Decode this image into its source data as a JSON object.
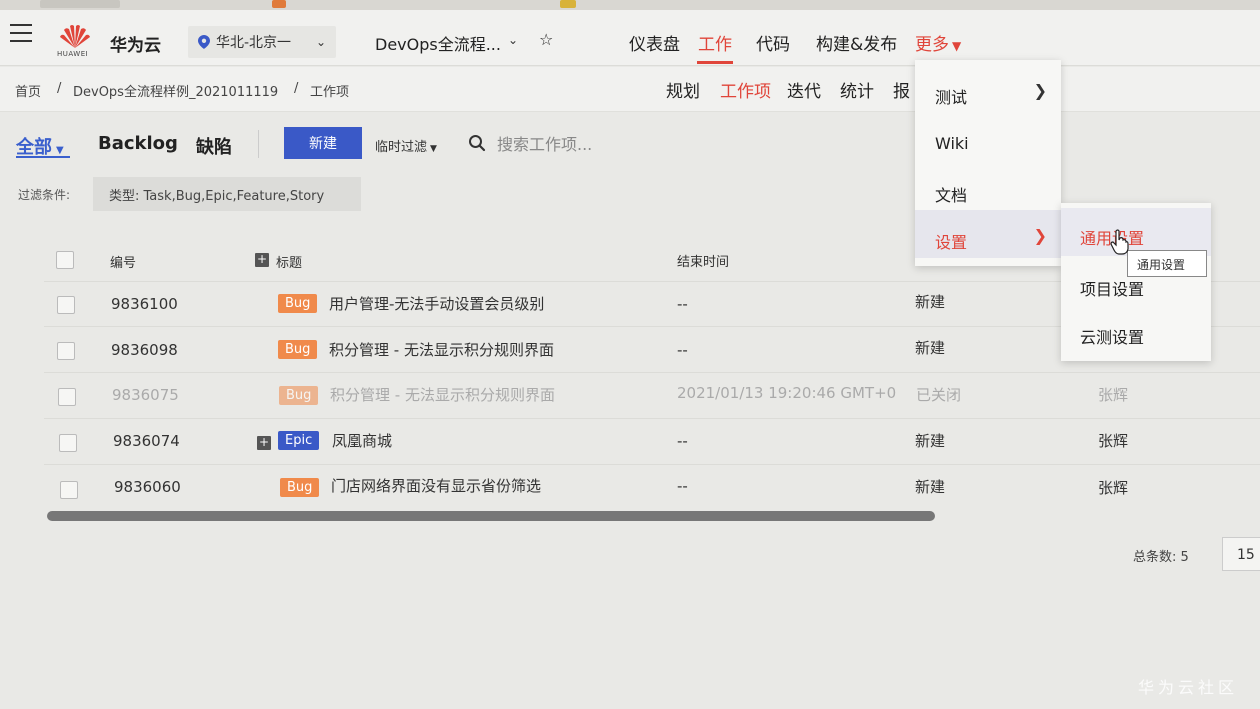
{
  "header": {
    "brand": "华为云",
    "logo_text": "HUAWEI",
    "region": "华北-北京一",
    "project": "DevOps全流程...",
    "nav": [
      "仪表盘",
      "工作",
      "代码",
      "构建&发布",
      "更多"
    ],
    "active_nav": "工作"
  },
  "breadcrumb": {
    "items": [
      "首页",
      "DevOps全流程样例_2021011119",
      "工作项"
    ],
    "separator": "/"
  },
  "subnav": [
    "规划",
    "工作项",
    "迭代",
    "统计",
    "报"
  ],
  "toolbar": {
    "tabs": [
      "全部",
      "Backlog",
      "缺陷"
    ],
    "new_button": "新建",
    "temp_filter": "临时过滤",
    "search_placeholder": "搜索工作项...",
    "filter_label": "过滤条件:",
    "filter_value": "类型: Task,Bug,Epic,Feature,Story"
  },
  "table": {
    "headers": {
      "id": "编号",
      "title": "标题",
      "end_time": "结束时间"
    },
    "rows": [
      {
        "id": "9836100",
        "type": "Bug",
        "title": "用户管理-无法手动设置会员级别",
        "end_time": "--",
        "status": "新建",
        "assignee": ""
      },
      {
        "id": "9836098",
        "type": "Bug",
        "title": "积分管理 - 无法显示积分规则界面",
        "end_time": "--",
        "status": "新建",
        "assignee": ""
      },
      {
        "id": "9836075",
        "type": "Bug",
        "title": "积分管理 - 无法显示积分规则界面",
        "end_time": "2021/01/13 19:20:46 GMT+0",
        "status": "已关闭",
        "assignee": "张辉"
      },
      {
        "id": "9836074",
        "type": "Epic",
        "title": "凤凰商城",
        "end_time": "--",
        "status": "新建",
        "assignee": "张辉"
      },
      {
        "id": "9836060",
        "type": "Bug",
        "title": "门店网络界面没有显示省份筛选",
        "end_time": "--",
        "status": "新建",
        "assignee": "张辉"
      }
    ]
  },
  "pagination": {
    "total_label": "总条数: 5",
    "page_size": "15"
  },
  "more_menu": {
    "items": [
      "测试",
      "Wiki",
      "文档",
      "设置"
    ]
  },
  "settings_submenu": {
    "items": [
      "通用设置",
      "项目设置",
      "云测设置"
    ],
    "tooltip": "通用设置"
  },
  "watermark": "华为云社区",
  "colors": {
    "accent_red": "#e0453a",
    "primary_blue": "#3a59c7",
    "bug_orange": "#f08a4b"
  }
}
